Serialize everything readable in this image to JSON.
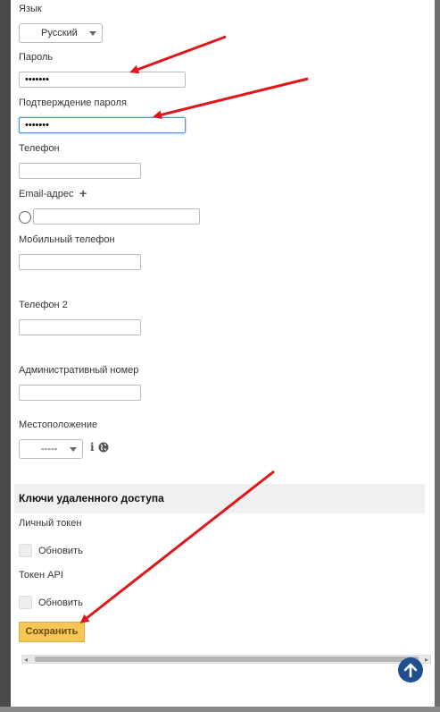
{
  "form": {
    "language": {
      "label": "Язык",
      "selected": "Русский"
    },
    "password": {
      "label": "Пароль",
      "value": "•••••••"
    },
    "password_confirm": {
      "label": "Подтверждение пароля",
      "value": "•••••••"
    },
    "phone": {
      "label": "Телефон",
      "value": ""
    },
    "email": {
      "label": "Email-адрес",
      "add_symbol": "+",
      "value": ""
    },
    "mobile": {
      "label": "Мобильный телефон",
      "value": ""
    },
    "phone2": {
      "label": "Телефон 2",
      "value": ""
    },
    "admin_number": {
      "label": "Административный номер",
      "value": ""
    },
    "location": {
      "label": "Местоположение",
      "selected": "-----",
      "info_symbol": "i"
    }
  },
  "remote_access": {
    "title": "Ключи удаленного доступа",
    "personal_token": {
      "label": "Личный токен",
      "checkbox_label": "Обновить"
    },
    "api_token": {
      "label": "Токен API",
      "checkbox_label": "Обновить"
    }
  },
  "actions": {
    "save_label": "Сохранить"
  },
  "scrollbar": {
    "left_arrow": "◂",
    "right_arrow": "▸"
  },
  "colors": {
    "accent_arrow": "#e0161b",
    "save_button": "#f6c756",
    "fab": "#1f4f8f",
    "focus_border": "#4a90d9"
  },
  "icons": [
    "plus-icon",
    "info-icon",
    "globe-icon",
    "arrow-up-icon",
    "chevron-left-icon",
    "chevron-right-icon"
  ]
}
